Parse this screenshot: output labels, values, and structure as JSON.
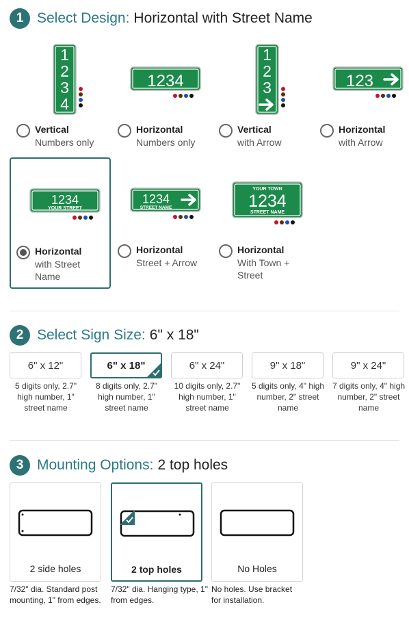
{
  "steps": [
    {
      "number": "1",
      "title": "Select Design:",
      "value": "Horizontal with Street Name"
    },
    {
      "number": "2",
      "title": "Select Sign Size:",
      "value": "6\" x 18\""
    },
    {
      "number": "3",
      "title": "Mounting Options:",
      "value": "2 top holes"
    }
  ],
  "colors": {
    "accent": "#2d6e6e",
    "title": "#2a7a86",
    "sign_green": "#1c8a4a",
    "swatches": [
      "#c8102e",
      "#5a2d0c",
      "#1f4fb5",
      "#111111"
    ]
  },
  "designs": [
    {
      "title": "Vertical",
      "subtitle": "Numbers only",
      "selected": false,
      "sign": {
        "digits": [
          "1",
          "2",
          "3",
          "4"
        ]
      }
    },
    {
      "title": "Horizontal",
      "subtitle": "Numbers only",
      "selected": false,
      "sign": {
        "number": "1234"
      }
    },
    {
      "title": "Vertical",
      "subtitle": "with Arrow",
      "selected": false,
      "sign": {
        "digits": [
          "1",
          "2",
          "3"
        ],
        "icon": "arrow-right-icon"
      }
    },
    {
      "title": "Horizontal",
      "subtitle": "with Arrow",
      "selected": false,
      "sign": {
        "number": "123",
        "icon": "arrow-right-icon"
      }
    },
    {
      "title": "Horizontal",
      "subtitle": "with Street Name",
      "selected": true,
      "sign": {
        "number": "1234",
        "street": "YOUR STREET"
      }
    },
    {
      "title": "Horizontal",
      "subtitle": "Street + Arrow",
      "selected": false,
      "sign": {
        "number": "1234",
        "street": "STREET NAME",
        "icon": "arrow-right-icon"
      }
    },
    {
      "title": "Horizontal",
      "subtitle": "With Town + Street",
      "selected": false,
      "sign": {
        "town": "YOUR TOWN",
        "number": "1234",
        "street": "STREET NAME"
      }
    }
  ],
  "sizes": [
    {
      "label": "6\" x 12\"",
      "desc": "5 digits only, 2.7\" high number, 1\" street name",
      "selected": false
    },
    {
      "label": "6\" x 18\"",
      "desc": "8 digits only, 2.7\" high number, 1\" street name",
      "selected": true
    },
    {
      "label": "6\" x 24\"",
      "desc": "10 digits only, 2.7\" high number, 1\" street name",
      "selected": false
    },
    {
      "label": "9\" x 18\"",
      "desc": "5 digits only, 4\" high number, 2\" street name",
      "selected": false
    },
    {
      "label": "9\" x 24\"",
      "desc": "7 digits only, 4\" high number, 2\" street name",
      "selected": false
    }
  ],
  "mounting": [
    {
      "label": "2 side holes",
      "desc": "7/32\" dia. Standard post mounting, 1\" from edges.",
      "selected": false,
      "holes": "side"
    },
    {
      "label": "2 top holes",
      "desc": "7/32\" dia. Hanging type, 1\" from edges.",
      "selected": true,
      "holes": "top"
    },
    {
      "label": "No Holes",
      "desc": "No holes. Use bracket for installation.",
      "selected": false,
      "holes": "none"
    }
  ]
}
